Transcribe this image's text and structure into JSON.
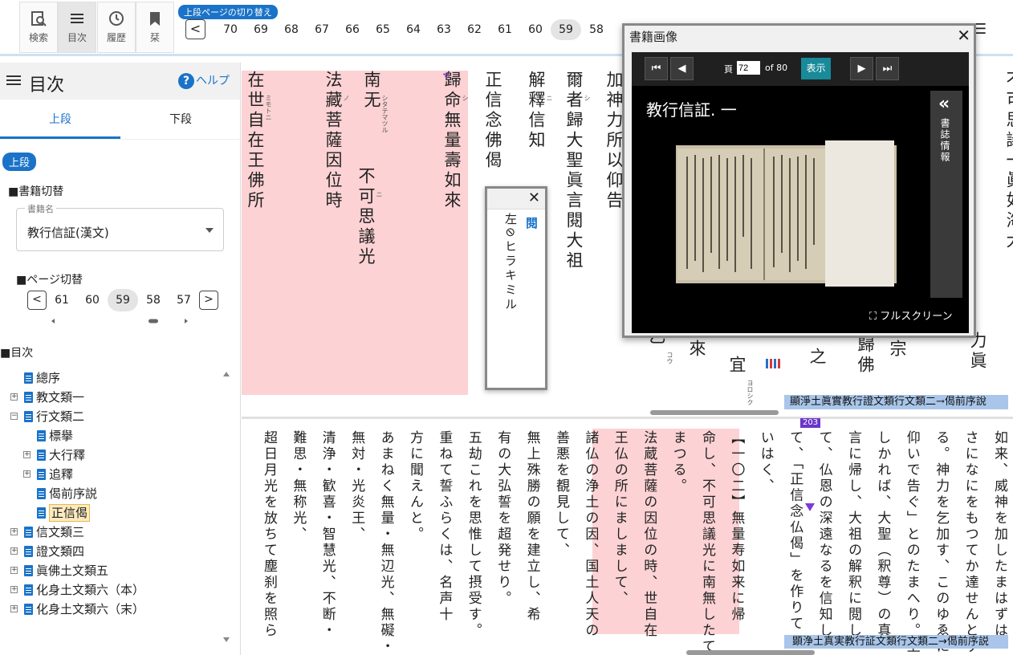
{
  "toolbar": {
    "buttons": [
      {
        "label": "検索",
        "icon": "search-doc-icon"
      },
      {
        "label": "目次",
        "icon": "list-icon"
      },
      {
        "label": "履歴",
        "icon": "history-icon"
      },
      {
        "label": "栞",
        "icon": "bookmark-icon"
      }
    ],
    "page_switch_label": "上段ページの切り替え",
    "prev": "<",
    "pages": [
      "70",
      "69",
      "68",
      "67",
      "66",
      "65",
      "64",
      "63",
      "62",
      "61",
      "60",
      "59",
      "58"
    ],
    "current_page": "59"
  },
  "sidebar": {
    "title": "目次",
    "help": "ヘルプ",
    "help_q": "?",
    "tabs": [
      "上段",
      "下段"
    ],
    "active_chip": "上段",
    "book_section": "■書籍切替",
    "book_legend": "書籍名",
    "book_value": "教行信証(漢文)",
    "page_section": "■ページ切替",
    "pager": {
      "prev": "<",
      "next": ">",
      "pages": [
        "61",
        "60",
        "59",
        "58",
        "57"
      ],
      "current": "59"
    },
    "toc_section": "■目次",
    "toc": [
      {
        "label": "總序",
        "indent": 0,
        "expand": ""
      },
      {
        "label": "教文類一",
        "indent": 0,
        "expand": "+"
      },
      {
        "label": "行文類二",
        "indent": 0,
        "expand": "−"
      },
      {
        "label": "標擧",
        "indent": 1,
        "expand": ""
      },
      {
        "label": "大行釋",
        "indent": 1,
        "expand": "+"
      },
      {
        "label": "追釋",
        "indent": 1,
        "expand": "+"
      },
      {
        "label": "偈前序説",
        "indent": 1,
        "expand": ""
      },
      {
        "label": "正信偈",
        "indent": 1,
        "expand": "",
        "selected": true
      },
      {
        "label": "信文類三",
        "indent": 0,
        "expand": "+"
      },
      {
        "label": "證文類四",
        "indent": 0,
        "expand": "+"
      },
      {
        "label": "眞佛土文類五",
        "indent": 0,
        "expand": "+"
      },
      {
        "label": "化身土文類六（本）",
        "indent": 0,
        "expand": "+"
      },
      {
        "label": "化身土文類六（末）",
        "indent": 0,
        "expand": "+"
      }
    ]
  },
  "upper_text": {
    "columns": [
      {
        "text": "不可思議光",
        "ruby": "ニ"
      },
      {
        "text": "歸命無量壽如來",
        "ruby": "シ"
      },
      {
        "text": "南无",
        "ruby": "シタテマツル"
      },
      {
        "text": "法藏菩薩因位時",
        "ruby": "ノ"
      },
      {
        "text": "在世自在王佛所",
        "ruby": "ミモトニ"
      },
      {
        "text": "正信念佛偈",
        "ruby": ""
      },
      {
        "text": "解釋信知",
        "ruby": "ニ"
      },
      {
        "text": "爾者歸大聖眞言閱大祖",
        "ruby": "シ"
      },
      {
        "text": "加神力所以仰告",
        "ruby": "クワウ"
      },
      {
        "text": "乙",
        "ruby": "コウ"
      },
      {
        "text": "來",
        "ruby": ""
      },
      {
        "text": "宜",
        "ruby": "ヨロシク"
      },
      {
        "text": "之",
        "ruby": ""
      },
      {
        "text": "歸佛",
        "ruby": ""
      },
      {
        "text": "宗",
        "ruby": ""
      },
      {
        "text": "力眞",
        "ruby": ""
      },
      {
        "text": "不可思議一眞如海大",
        "ruby": "チ"
      }
    ],
    "footer": "顯淨土眞實教行證文類行文類二→偈前序說"
  },
  "lower_text": {
    "columns": [
      "如来、威神を加したまはずは、ま",
      "さになにをもつてか達せんとす",
      "る。神力を乞加す、このゆゑに",
      "仰いで告ぐ」とのたまへり。上以",
      "しかれば、大聖（釈尊）の真",
      "言に帰し、大祖の解釈に閲し",
      "て、仏恩の深遠なるを信知し",
      "て、「正信念仏偈」を作りて",
      "いはく、",
      "【一〇二】無量寿如来に帰",
      "命し、不可思議光に南無したて",
      "まつる。",
      "法蔵菩薩の因位の時、世自在",
      "王仏の所にましまして、",
      "諸仏の浄土の因、国土人天の",
      "善悪を覩見して、",
      "無上殊勝の願を建立し、希",
      "有の大弘誓を超発せり。",
      "五劫これを思惟して摂受す。",
      "重ねて誓ふらくは、名声十",
      "方に聞えんと。",
      "あまねく無量・無辺光、無礙・",
      "無対・光炎王、",
      "清浄・歓喜・智慧光、不断・",
      "難思・無称光、",
      "超日月光を放ちて塵刹を照ら"
    ],
    "page_badge": "203",
    "footer": "顕浄土真実教行証文類行文類二→偈前序説"
  },
  "note_popup": {
    "kanji": "閱",
    "text": "左⊘ヒラキミル",
    "close": "✕"
  },
  "image_window": {
    "title": "書籍画像",
    "close": "✕",
    "page_label": "頁",
    "page_value": "72",
    "of_label": "of 80",
    "show_button": "表示",
    "book_title": "教行信証. 一",
    "side_label": "書誌情報",
    "side_chevron": "«",
    "fullscreen": "フルスクリーン",
    "first": "⏮",
    "prev": "◀",
    "next": "▶",
    "last": "⏭"
  },
  "colors": {
    "accent": "#1a73c8",
    "highlight": "#fcd2d4",
    "footer_bar": "#a9c6ea",
    "badge": "#6a35c8",
    "show_button": "#198a9a"
  }
}
